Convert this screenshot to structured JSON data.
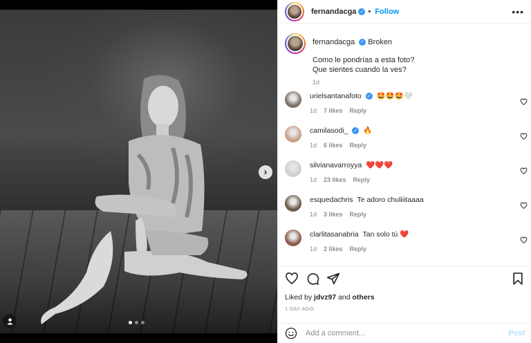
{
  "post": {
    "author": "fernandacga",
    "follow_label": "Follow",
    "separator": "•",
    "more_label": "•••",
    "caption_title": "Broken",
    "caption_line1": "Como le pondrías a esta foto?",
    "caption_line2": "Que sientes cuando la ves?",
    "caption_time": "1d",
    "image_count": 3,
    "active_image": 1
  },
  "comments": [
    {
      "user": "urielsantanafoto",
      "verified": true,
      "text": "🤩🤩🤩🤍",
      "time": "1d",
      "likes": "7 likes",
      "reply": "Reply",
      "avatar_color": "#7b6f66"
    },
    {
      "user": "camilasodi_",
      "verified": true,
      "text": "🔥",
      "time": "1d",
      "likes": "6 likes",
      "reply": "Reply",
      "avatar_color": "#c9a089"
    },
    {
      "user": "silvianavarroyya",
      "verified": false,
      "text": "❤️❤️❤️",
      "time": "1d",
      "likes": "23 likes",
      "reply": "Reply",
      "avatar_color": "#cfcfcf"
    },
    {
      "user": "esquedachris",
      "verified": false,
      "text": "Te adoro chuliiitaaaa",
      "time": "1d",
      "likes": "3 likes",
      "reply": "Reply",
      "avatar_color": "#6b5a4b"
    },
    {
      "user": "clarlitasanabria",
      "verified": false,
      "text": "Tan solo tú ❤️",
      "time": "1d",
      "likes": "2 likes",
      "reply": "Reply",
      "avatar_color": "#8a5a4a"
    }
  ],
  "likes": {
    "prefix": "Liked by",
    "user": "jdvz97",
    "conj": "and",
    "others": "others",
    "time_ago": "1 DAY AGO"
  },
  "composer": {
    "placeholder": "Add a comment...",
    "post_label": "Post"
  },
  "icons": {
    "heart": "heart-icon",
    "comment": "comment-icon",
    "share": "share-icon",
    "save": "bookmark-icon",
    "emoji": "emoji-icon",
    "next": "chevron-right-icon",
    "tag": "user-tag-icon"
  },
  "colors": {
    "accent": "#0095f6",
    "verified": "#3897f0",
    "muted": "#8e8e8e",
    "post_disabled": "#b2dffc"
  }
}
